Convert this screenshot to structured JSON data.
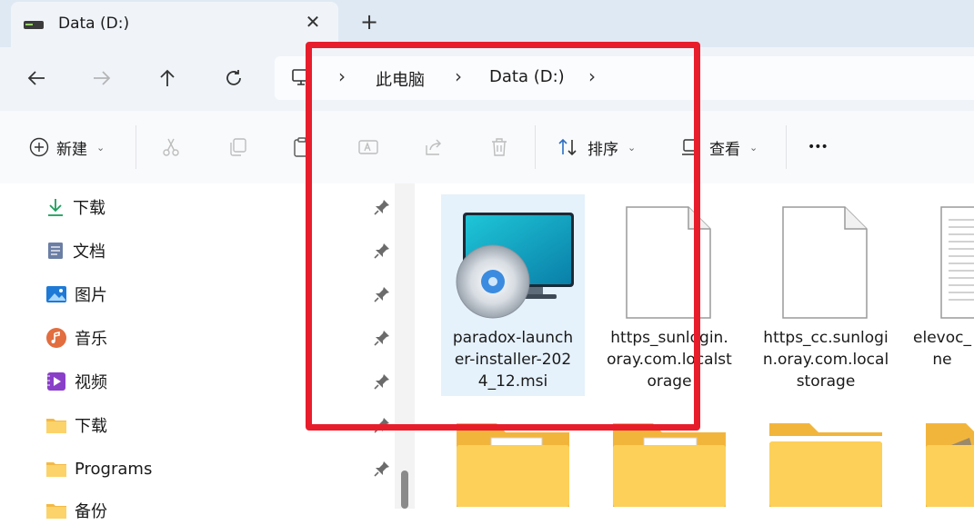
{
  "tab": {
    "title": "Data (D:)",
    "close_glyph": "✕",
    "new_tab_glyph": "+"
  },
  "address": {
    "crumbs": [
      "此电脑",
      "Data (D:)"
    ],
    "chevron": "›"
  },
  "toolbar": {
    "new_label": "新建",
    "sort_label": "排序",
    "view_label": "查看",
    "more_glyph": "•••",
    "dropdown_glyph": "⌄"
  },
  "sidebar": {
    "items": [
      {
        "label": "下载",
        "icon": "download-icon"
      },
      {
        "label": "文档",
        "icon": "document-icon"
      },
      {
        "label": "图片",
        "icon": "pictures-icon"
      },
      {
        "label": "音乐",
        "icon": "music-icon"
      },
      {
        "label": "视频",
        "icon": "video-icon"
      },
      {
        "label": "下载",
        "icon": "folder-icon"
      },
      {
        "label": "Programs",
        "icon": "folder-icon"
      },
      {
        "label": "备份",
        "icon": "folder-icon"
      }
    ]
  },
  "files": [
    {
      "name": "paradox-launcher-installer-2024_12.msi",
      "lines": [
        "paradox-launch",
        "er-installer-202",
        "4_12.msi"
      ],
      "icon": "installer-icon",
      "selected": true
    },
    {
      "name": "https_sunlogin.oray.com.localstorage",
      "lines": [
        "https_sunlogin.",
        "oray.com.localst",
        "orage"
      ],
      "icon": "blank-file-icon",
      "selected": false
    },
    {
      "name": "https_cc.sunlogin.oray.com.localstorage",
      "lines": [
        "https_cc.sunlogi",
        "n.oray.com.local",
        "storage"
      ],
      "icon": "blank-file-icon",
      "selected": false
    },
    {
      "name": "elevoc_ne",
      "lines": [
        "elevoc_",
        "ne"
      ],
      "icon": "text-file-icon",
      "selected": false
    }
  ],
  "colors": {
    "highlight": "#e81d2c",
    "selection": "#e5f1fb",
    "folder": "#f8c94d"
  }
}
